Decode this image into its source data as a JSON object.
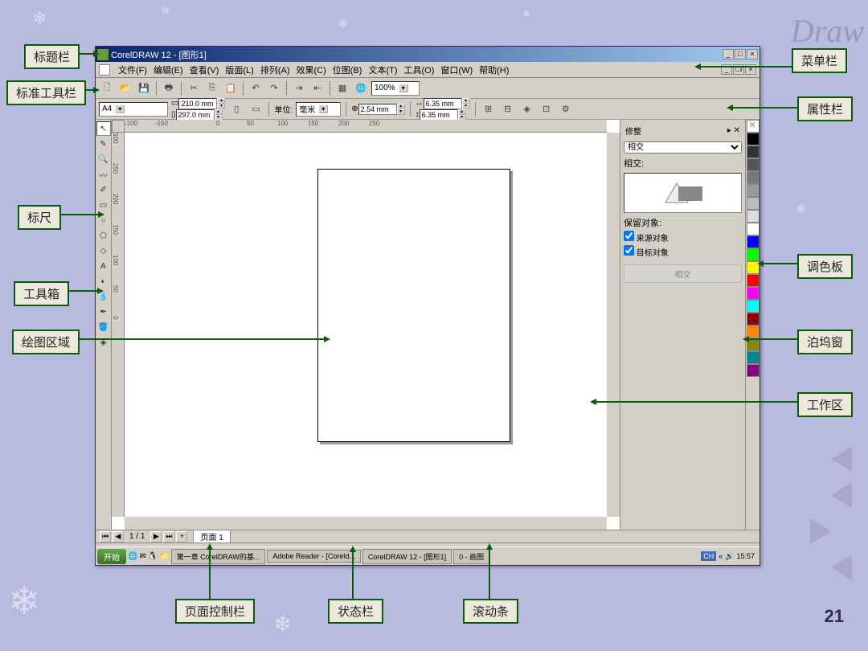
{
  "slide_number": "21",
  "watermark": "Draw",
  "callouts": {
    "title_bar": "标题栏",
    "menu_bar": "菜单栏",
    "std_toolbar": "标准工具栏",
    "property_bar": "属性栏",
    "ruler": "标尺",
    "color_palette": "调色板",
    "toolbox": "工具箱",
    "docker": "泊坞窗",
    "drawing_area": "绘图区域",
    "workspace": "工作区",
    "page_control": "页面控制栏",
    "status_bar": "状态栏",
    "scroll_bar": "滚动条"
  },
  "title": "CorelDRAW 12 - [图形1]",
  "menus": [
    "文件(F)",
    "编辑(E)",
    "查看(V)",
    "版面(L)",
    "排列(A)",
    "效果(C)",
    "位图(B)",
    "文本(T)",
    "工具(O)",
    "窗口(W)",
    "帮助(H)"
  ],
  "zoom": "100%",
  "property": {
    "paper": "A4",
    "width": "210.0 mm",
    "height": "297.0 mm",
    "unit_label": "单位:",
    "unit": "毫米",
    "nudge": "2.54 mm",
    "dup_x": "6.35 mm",
    "dup_y": "6.35 mm"
  },
  "ruler_h": [
    "-100",
    "-150",
    "",
    "0",
    "50",
    "100",
    "150",
    "200",
    "250"
  ],
  "ruler_v": [
    "300",
    "250",
    "200",
    "150",
    "100",
    "50",
    "0"
  ],
  "docker_panel": {
    "title": "修整",
    "mode": "相交",
    "section": "相交:",
    "keep": "保留对象:",
    "opt1": "来源对象",
    "opt2": "目标对象",
    "button": "相交"
  },
  "palette_colors": [
    "none",
    "#000",
    "#333",
    "#555",
    "#777",
    "#999",
    "#bbb",
    "#ddd",
    "#fff",
    "#00f",
    "#0f0",
    "#ff0",
    "#f00",
    "#f0f",
    "#0ff",
    "#800",
    "#f80",
    "#880",
    "#088",
    "#808"
  ],
  "page_control": {
    "pages": "1 / 1",
    "tab": "页面 1"
  },
  "taskbar": {
    "start": "开始",
    "tasks": [
      "第一章 CorelDRAW的基...",
      "Adobe Reader - [Coreld...",
      "CorelDRAW 12 - [图形1]",
      "0 - 画图"
    ],
    "lang": "CH",
    "time": "15:57"
  }
}
